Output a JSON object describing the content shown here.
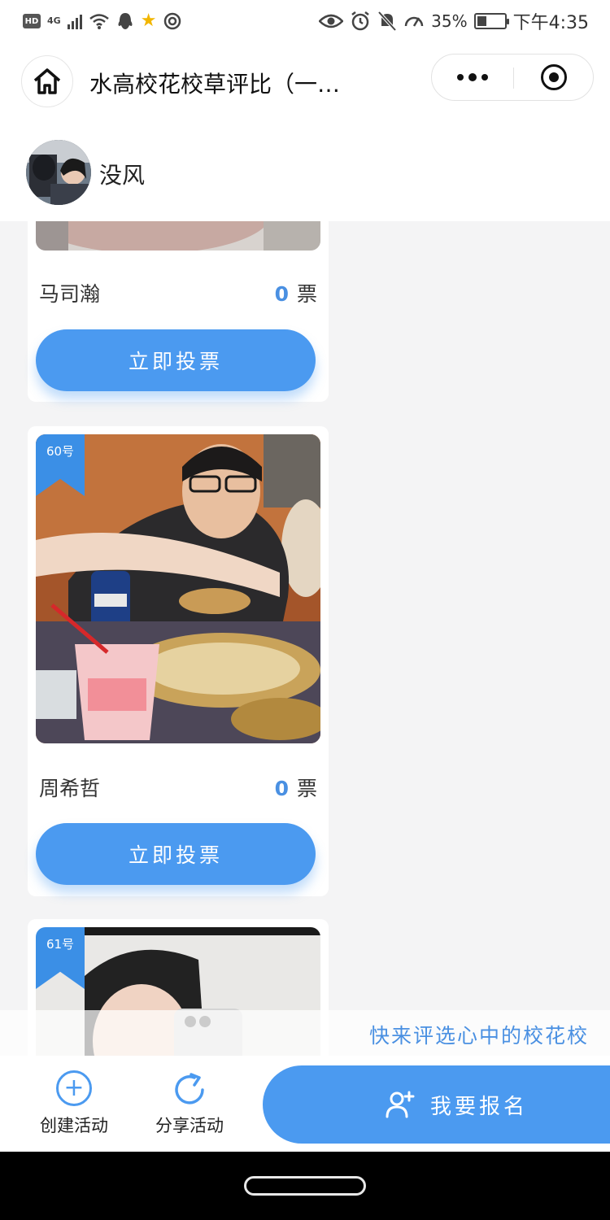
{
  "status_bar": {
    "hd": "HD",
    "network": "4G",
    "battery_percent": "35%",
    "battery_level": 0.35,
    "time": "下午4:35",
    "icons_left": [
      "hd-icon",
      "signal-icon",
      "wifi-icon",
      "qq-icon",
      "star-icon",
      "gps-icon"
    ],
    "icons_right": [
      "eye-icon",
      "alarm-icon",
      "mute-icon",
      "speed-icon",
      "battery-icon"
    ]
  },
  "nav": {
    "title": "水高校花校草评比（一…"
  },
  "user": {
    "name": "没风"
  },
  "cards": [
    {
      "name": "马司瀚",
      "votes": "0",
      "vote_unit": "票",
      "vote_button": "立即投票"
    },
    {
      "number": "60号",
      "name": "周希哲",
      "votes": "0",
      "vote_unit": "票",
      "vote_button": "立即投票"
    },
    {
      "number": "61号"
    }
  ],
  "marquee": {
    "text": "快来评选心中的校花校"
  },
  "toolbar": {
    "create_label": "创建活动",
    "share_label": "分享活动",
    "signup_label": "我要报名"
  },
  "colors": {
    "accent": "#4b9af0",
    "ribbon": "#3b8fe6",
    "vote_number": "#4a90e2",
    "background": "#f4f4f5"
  }
}
